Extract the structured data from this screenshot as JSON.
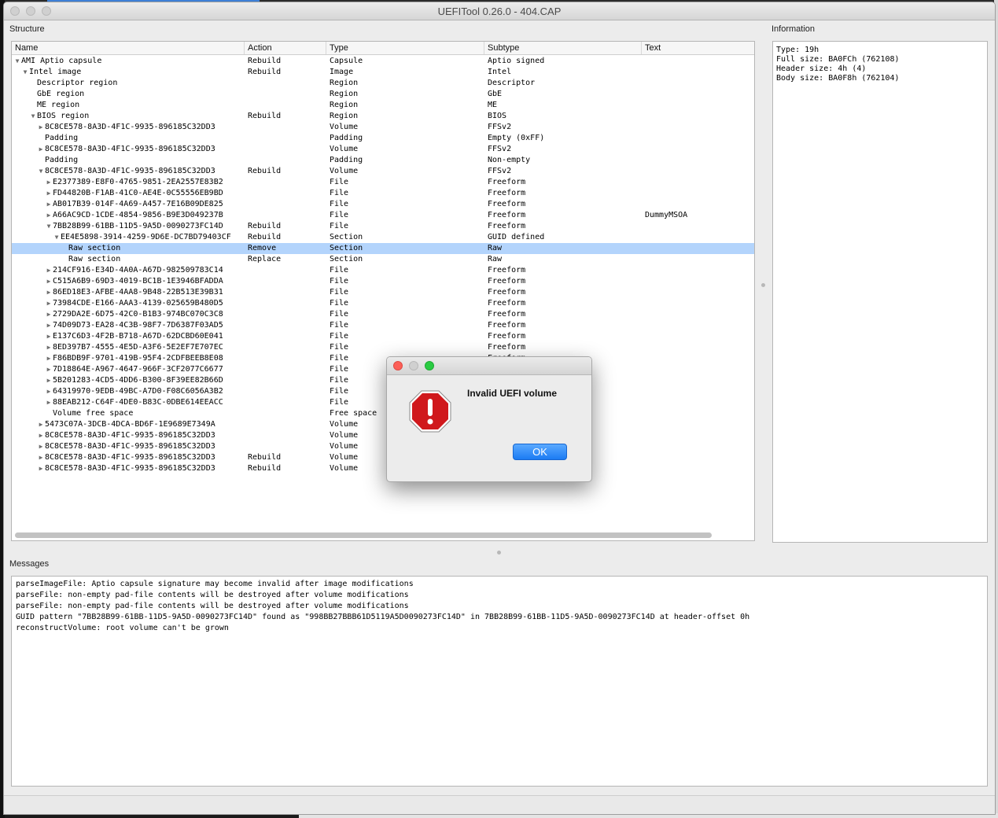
{
  "window": {
    "title": "UEFITool 0.26.0 - 404.CAP"
  },
  "panels": {
    "structure_label": "Structure",
    "information_label": "Information",
    "messages_label": "Messages"
  },
  "tree": {
    "columns": [
      "Name",
      "Action",
      "Type",
      "Subtype",
      "Text"
    ],
    "rows": [
      {
        "arrow": "down",
        "depth": 0,
        "name": "AMI Aptio capsule",
        "action": "Rebuild",
        "type": "Capsule",
        "subtype": "Aptio signed",
        "text": ""
      },
      {
        "arrow": "down",
        "depth": 1,
        "name": "Intel image",
        "action": "Rebuild",
        "type": "Image",
        "subtype": "Intel",
        "text": ""
      },
      {
        "arrow": "",
        "depth": 2,
        "name": "Descriptor region",
        "action": "",
        "type": "Region",
        "subtype": "Descriptor",
        "text": ""
      },
      {
        "arrow": "",
        "depth": 2,
        "name": "GbE region",
        "action": "",
        "type": "Region",
        "subtype": "GbE",
        "text": ""
      },
      {
        "arrow": "",
        "depth": 2,
        "name": "ME region",
        "action": "",
        "type": "Region",
        "subtype": "ME",
        "text": ""
      },
      {
        "arrow": "down",
        "depth": 2,
        "name": "BIOS region",
        "action": "Rebuild",
        "type": "Region",
        "subtype": "BIOS",
        "text": ""
      },
      {
        "arrow": "right",
        "depth": 3,
        "name": "8C8CE578-8A3D-4F1C-9935-896185C32DD3",
        "action": "",
        "type": "Volume",
        "subtype": "FFSv2",
        "text": ""
      },
      {
        "arrow": "",
        "depth": 3,
        "name": "Padding",
        "action": "",
        "type": "Padding",
        "subtype": "Empty (0xFF)",
        "text": ""
      },
      {
        "arrow": "right",
        "depth": 3,
        "name": "8C8CE578-8A3D-4F1C-9935-896185C32DD3",
        "action": "",
        "type": "Volume",
        "subtype": "FFSv2",
        "text": ""
      },
      {
        "arrow": "",
        "depth": 3,
        "name": "Padding",
        "action": "",
        "type": "Padding",
        "subtype": "Non-empty",
        "text": ""
      },
      {
        "arrow": "down",
        "depth": 3,
        "name": "8C8CE578-8A3D-4F1C-9935-896185C32DD3",
        "action": "Rebuild",
        "type": "Volume",
        "subtype": "FFSv2",
        "text": ""
      },
      {
        "arrow": "right",
        "depth": 4,
        "name": "E2377389-E8F0-4765-9851-2EA2557E83B2",
        "action": "",
        "type": "File",
        "subtype": "Freeform",
        "text": ""
      },
      {
        "arrow": "right",
        "depth": 4,
        "name": "FD44820B-F1AB-41C0-AE4E-0C55556EB9BD",
        "action": "",
        "type": "File",
        "subtype": "Freeform",
        "text": ""
      },
      {
        "arrow": "right",
        "depth": 4,
        "name": "AB017B39-014F-4A69-A457-7E16B09DE825",
        "action": "",
        "type": "File",
        "subtype": "Freeform",
        "text": ""
      },
      {
        "arrow": "right",
        "depth": 4,
        "name": "A66AC9CD-1CDE-4854-9856-B9E3D049237B",
        "action": "",
        "type": "File",
        "subtype": "Freeform",
        "text": "DummyMSOA"
      },
      {
        "arrow": "down",
        "depth": 4,
        "name": "7BB28B99-61BB-11D5-9A5D-0090273FC14D",
        "action": "Rebuild",
        "type": "File",
        "subtype": "Freeform",
        "text": ""
      },
      {
        "arrow": "down",
        "depth": 5,
        "name": "EE4E5898-3914-4259-9D6E-DC7BD79403CF",
        "action": "Rebuild",
        "type": "Section",
        "subtype": "GUID defined",
        "text": ""
      },
      {
        "arrow": "",
        "depth": 6,
        "name": "Raw section",
        "action": "Remove",
        "type": "Section",
        "subtype": "Raw",
        "text": "",
        "selected": true
      },
      {
        "arrow": "",
        "depth": 6,
        "name": "Raw section",
        "action": "Replace",
        "type": "Section",
        "subtype": "Raw",
        "text": ""
      },
      {
        "arrow": "right",
        "depth": 4,
        "name": "214CF916-E34D-4A0A-A67D-982509783C14",
        "action": "",
        "type": "File",
        "subtype": "Freeform",
        "text": ""
      },
      {
        "arrow": "right",
        "depth": 4,
        "name": "C515A6B9-69D3-4019-BC1B-1E3946BFADDA",
        "action": "",
        "type": "File",
        "subtype": "Freeform",
        "text": ""
      },
      {
        "arrow": "right",
        "depth": 4,
        "name": "86ED18E3-AFBE-4AA8-9B48-22B513E39B31",
        "action": "",
        "type": "File",
        "subtype": "Freeform",
        "text": ""
      },
      {
        "arrow": "right",
        "depth": 4,
        "name": "73984CDE-E166-AAA3-4139-025659B480D5",
        "action": "",
        "type": "File",
        "subtype": "Freeform",
        "text": ""
      },
      {
        "arrow": "right",
        "depth": 4,
        "name": "2729DA2E-6D75-42C0-B1B3-974BC070C3C8",
        "action": "",
        "type": "File",
        "subtype": "Freeform",
        "text": ""
      },
      {
        "arrow": "right",
        "depth": 4,
        "name": "74D09D73-EA28-4C3B-98F7-7D6387F03AD5",
        "action": "",
        "type": "File",
        "subtype": "Freeform",
        "text": ""
      },
      {
        "arrow": "right",
        "depth": 4,
        "name": "E137C6D3-4F2B-B718-A67D-62DCBD60E041",
        "action": "",
        "type": "File",
        "subtype": "Freeform",
        "text": ""
      },
      {
        "arrow": "right",
        "depth": 4,
        "name": "8ED397B7-4555-4E5D-A3F6-5E2EF7E707EC",
        "action": "",
        "type": "File",
        "subtype": "Freeform",
        "text": ""
      },
      {
        "arrow": "right",
        "depth": 4,
        "name": "F86BDB9F-9701-419B-95F4-2CDFBEEB8E08",
        "action": "",
        "type": "File",
        "subtype": "Freeform",
        "text": ""
      },
      {
        "arrow": "right",
        "depth": 4,
        "name": "7D18864E-A967-4647-966F-3CF2077C6677",
        "action": "",
        "type": "File",
        "subtype": "",
        "text": ""
      },
      {
        "arrow": "right",
        "depth": 4,
        "name": "5B201283-4CD5-4DD6-B300-8F39EE82B66D",
        "action": "",
        "type": "File",
        "subtype": "",
        "text": ""
      },
      {
        "arrow": "right",
        "depth": 4,
        "name": "64319970-9EDB-49BC-A7D0-F08C6056A3B2",
        "action": "",
        "type": "File",
        "subtype": "",
        "text": ""
      },
      {
        "arrow": "right",
        "depth": 4,
        "name": "88EAB212-C64F-4DE0-B83C-0DBE614EEACC",
        "action": "",
        "type": "File",
        "subtype": "",
        "text": ""
      },
      {
        "arrow": "",
        "depth": 4,
        "name": "Volume free space",
        "action": "",
        "type": "Free space",
        "subtype": "",
        "text": ""
      },
      {
        "arrow": "right",
        "depth": 3,
        "name": "5473C07A-3DCB-4DCA-BD6F-1E9689E7349A",
        "action": "",
        "type": "Volume",
        "subtype": "",
        "text": ""
      },
      {
        "arrow": "right",
        "depth": 3,
        "name": "8C8CE578-8A3D-4F1C-9935-896185C32DD3",
        "action": "",
        "type": "Volume",
        "subtype": "",
        "text": ""
      },
      {
        "arrow": "right",
        "depth": 3,
        "name": "8C8CE578-8A3D-4F1C-9935-896185C32DD3",
        "action": "",
        "type": "Volume",
        "subtype": "",
        "text": ""
      },
      {
        "arrow": "right",
        "depth": 3,
        "name": "8C8CE578-8A3D-4F1C-9935-896185C32DD3",
        "action": "Rebuild",
        "type": "Volume",
        "subtype": "",
        "text": ""
      },
      {
        "arrow": "right",
        "depth": 3,
        "name": "8C8CE578-8A3D-4F1C-9935-896185C32DD3",
        "action": "Rebuild",
        "type": "Volume",
        "subtype": "",
        "text": ""
      }
    ]
  },
  "info": {
    "lines": [
      "Type: 19h",
      "Full size: BA0FCh (762108)",
      "Header size: 4h (4)",
      "Body size: BA0F8h (762104)"
    ]
  },
  "messages": {
    "lines": [
      "parseImageFile: Aptio capsule signature may become invalid after image modifications",
      "parseFile: non-empty pad-file contents will be destroyed after volume modifications",
      "parseFile: non-empty pad-file contents will be destroyed after volume modifications",
      "GUID pattern \"7BB28B99-61BB-11D5-9A5D-0090273FC14D\" found as \"998BB27BBB61D5119A5D0090273FC14D\" in 7BB28B99-61BB-11D5-9A5D-0090273FC14D at header-offset 0h",
      "reconstructVolume: root volume can't be grown"
    ]
  },
  "dialog": {
    "message": "Invalid UEFI volume",
    "ok_label": "OK",
    "icon": "stop-alert-icon"
  },
  "colors": {
    "selection": "#b3d4fc",
    "ok_button": "#1b7bf3",
    "alert_red": "#d0181c"
  }
}
